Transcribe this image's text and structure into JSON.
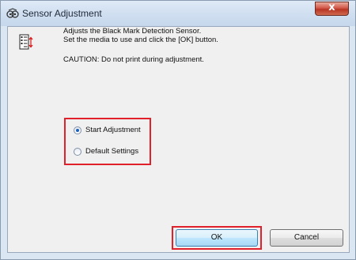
{
  "window": {
    "title": "Sensor Adjustment",
    "close_label": "x"
  },
  "content": {
    "line1": "Adjusts the Black Mark Detection Sensor.",
    "line2": "Set the media to use and click the [OK] button.",
    "caution": "CAUTION: Do not print during adjustment."
  },
  "options": {
    "start_label": "Start Adjustment",
    "default_label": "Default Settings",
    "selected": "Start Adjustment"
  },
  "buttons": {
    "ok_label": "OK",
    "cancel_label": "Cancel"
  },
  "colors": {
    "highlight": "#e0202a",
    "titlebar": "#d2e0f1"
  }
}
